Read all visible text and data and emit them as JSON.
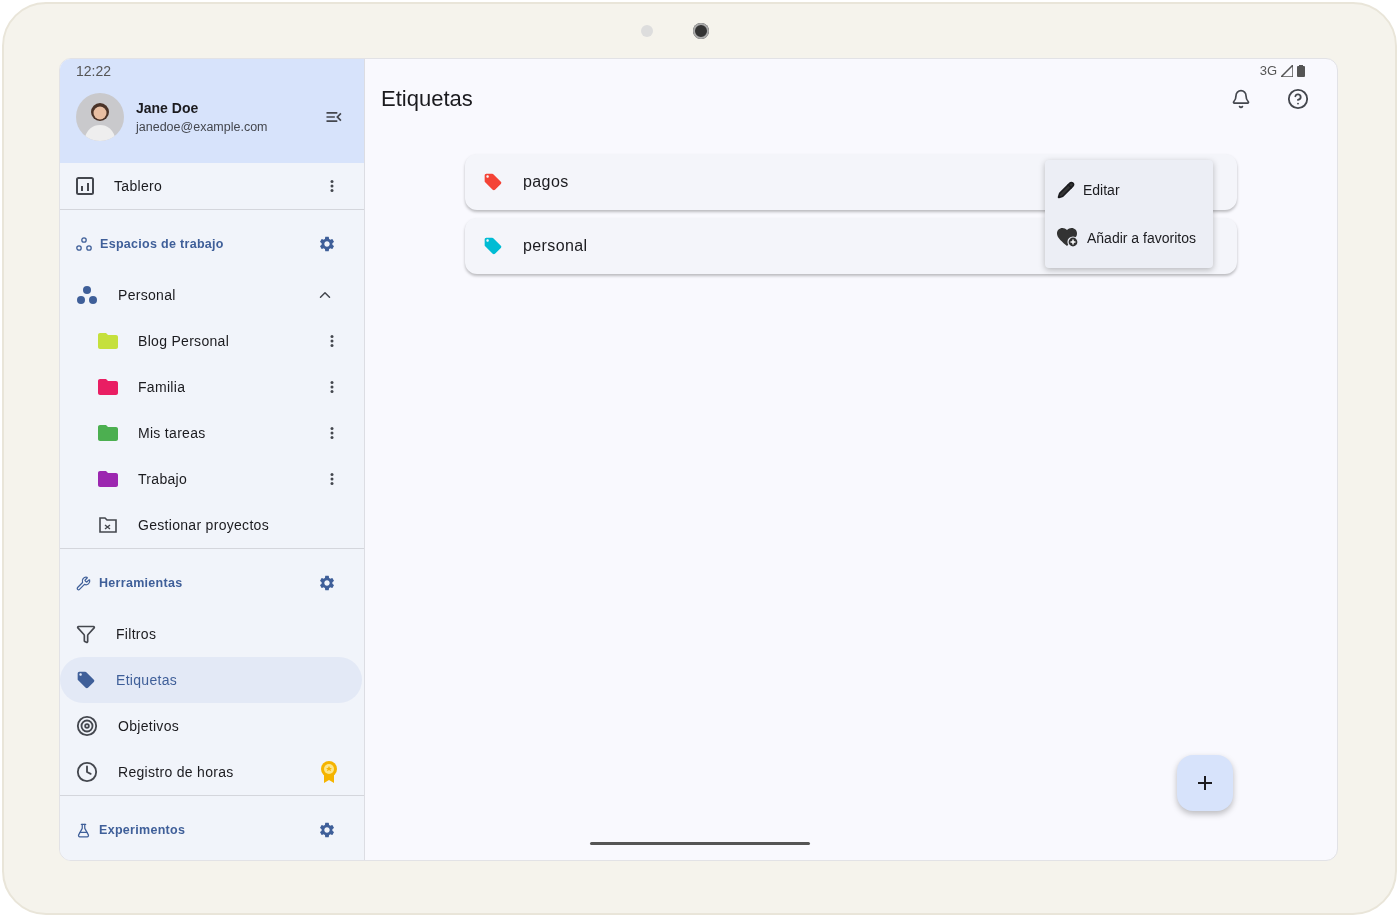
{
  "status_bar": {
    "time": "12:22",
    "network": "3G"
  },
  "profile": {
    "name": "Jane Doe",
    "email": "janedoe@example.com"
  },
  "sidebar": {
    "top_item": {
      "label": "Tablero"
    },
    "workspaces": {
      "title": "Espacios de trabajo",
      "group": {
        "label": "Personal",
        "expanded": true
      },
      "projects": [
        {
          "label": "Blog Personal",
          "color": "#c5e03c"
        },
        {
          "label": "Familia",
          "color": "#e91e63"
        },
        {
          "label": "Mis tareas",
          "color": "#4caf50"
        },
        {
          "label": "Trabajo",
          "color": "#9c27b0"
        }
      ],
      "manage": "Gestionar proyectos"
    },
    "tools": {
      "title": "Herramientas",
      "items": [
        {
          "label": "Filtros",
          "selected": false
        },
        {
          "label": "Etiquetas",
          "selected": true
        },
        {
          "label": "Objetivos",
          "selected": false
        },
        {
          "label": "Registro de horas",
          "selected": false
        }
      ]
    },
    "experiments": {
      "title": "Experimentos"
    }
  },
  "main": {
    "title": "Etiquetas",
    "labels": [
      {
        "name": "pagos",
        "color": "#f44336"
      },
      {
        "name": "personal",
        "color": "#00bcd4"
      }
    ],
    "menu": [
      {
        "label": "Editar"
      },
      {
        "label": "Añadir a favoritos"
      }
    ]
  }
}
